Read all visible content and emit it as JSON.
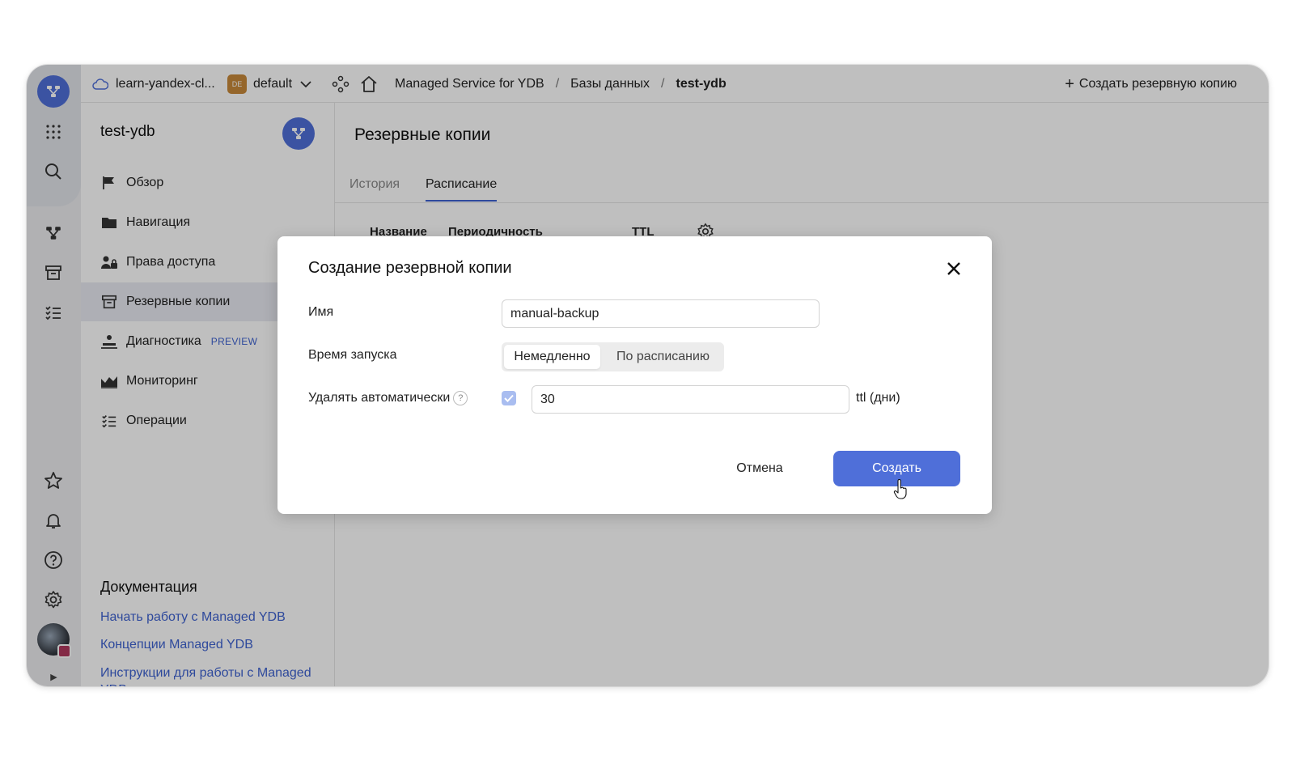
{
  "topbar": {
    "cloud": "learn-yandex-cl...",
    "folder_badge": "DE",
    "folder": "default",
    "breadcrumbs": [
      "Managed Service for YDB",
      "Базы данных",
      "test-ydb"
    ],
    "create_backup": "Создать резервную копию"
  },
  "sidebar": {
    "title": "test-ydb",
    "items": [
      {
        "label": "Обзор",
        "icon": "flag-icon"
      },
      {
        "label": "Навигация",
        "icon": "folder-icon"
      },
      {
        "label": "Права доступа",
        "icon": "users-lock-icon"
      },
      {
        "label": "Резервные копии",
        "icon": "archive-icon",
        "active": true
      },
      {
        "label": "Диагностика",
        "icon": "diagnostics-icon",
        "badge": "PREVIEW"
      },
      {
        "label": "Мониторинг",
        "icon": "chart-icon"
      },
      {
        "label": "Операции",
        "icon": "list-check-icon"
      }
    ],
    "docs_title": "Документация",
    "docs_links": [
      "Начать работу с Managed YDB",
      "Концепции Managed YDB",
      "Инструкции для работы с Managed YDB"
    ]
  },
  "main": {
    "title": "Резервные копии",
    "tabs": [
      "История",
      "Расписание"
    ],
    "active_tab": "Расписание",
    "columns": [
      "Название",
      "Периодичность",
      "TTL"
    ]
  },
  "dialog": {
    "title": "Создание резервной копии",
    "name_label": "Имя",
    "name_value": "manual-backup",
    "start_label": "Время запуска",
    "start_options": [
      "Немедленно",
      "По расписанию"
    ],
    "start_selected": "Немедленно",
    "auto_delete_label": "Удалять автоматически",
    "help_glyph": "?",
    "auto_delete_checked": true,
    "ttl_value": "30",
    "ttl_unit": "ttl (дни)",
    "cancel": "Отмена",
    "create": "Создать"
  },
  "colors": {
    "accent": "#4f6fd9",
    "link": "#3e62d0",
    "folder_badge": "#c7893a"
  }
}
